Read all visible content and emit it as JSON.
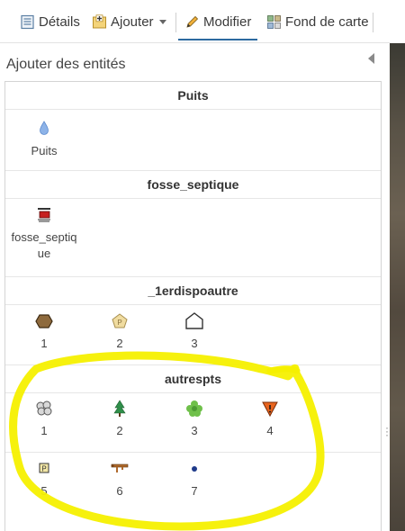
{
  "toolbar": {
    "details_label": "Détails",
    "add_label": "Ajouter",
    "modify_label": "Modifier",
    "basemap_label": "Fond de carte"
  },
  "panel": {
    "title": "Ajouter des entités"
  },
  "groups": [
    {
      "name": "Puits",
      "items": [
        {
          "label": "Puits",
          "icon": "water-drop-icon"
        }
      ]
    },
    {
      "name": "fosse_septique",
      "items": [
        {
          "label_line1": "fosse_septiq",
          "label_line2": "ue",
          "icon": "septic-tank-icon"
        }
      ]
    },
    {
      "name": "_1erdispoautre",
      "items": [
        {
          "label": "1",
          "icon": "brown-hexagon-icon"
        },
        {
          "label": "2",
          "icon": "tan-pentagon-icon"
        },
        {
          "label": "3",
          "icon": "pentagon-outline-icon"
        }
      ]
    },
    {
      "name": "autrespts",
      "items": [
        {
          "label": "1",
          "icon": "bushes-icon"
        },
        {
          "label": "2",
          "icon": "conifer-tree-icon"
        },
        {
          "label": "3",
          "icon": "deciduous-tree-icon"
        },
        {
          "label": "4",
          "icon": "warning-triangle-icon"
        },
        {
          "label": "5",
          "icon": "sign-post-icon"
        },
        {
          "label": "6",
          "icon": "brown-pipe-icon"
        },
        {
          "label": "7",
          "icon": "blue-dot-icon"
        }
      ]
    }
  ],
  "colors": {
    "active_tab_underline": "#2c6aa0",
    "highlight_marker": "#f5f000"
  }
}
